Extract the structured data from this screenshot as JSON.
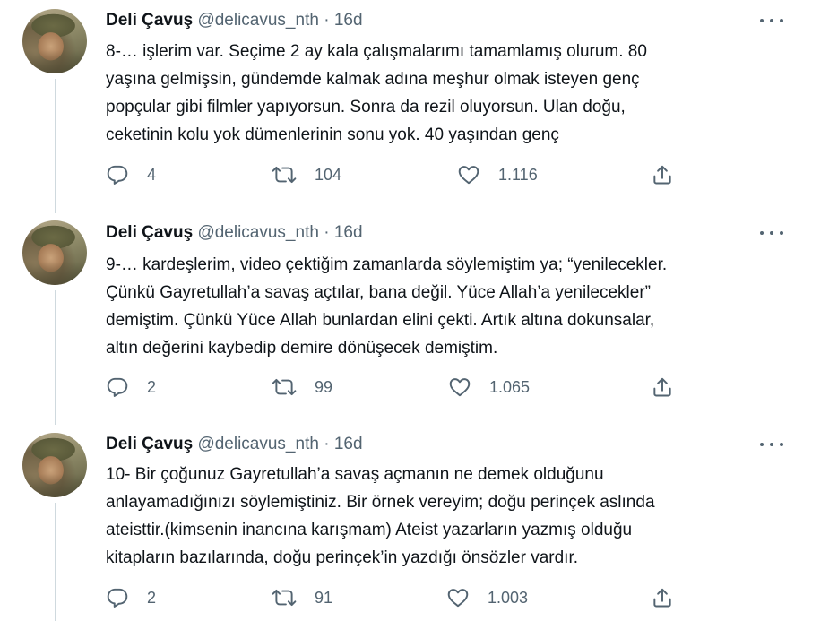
{
  "tweets": [
    {
      "name": "Deli Çavuş",
      "handle": "@delicavus_nth",
      "dot": "·",
      "time": "16d",
      "lines": [
        "8-… işlerim var. Seçime 2 ay kala çalışmalarımı tamamlamış olurum. 80",
        "yaşına gelmişsin, gündemde kalmak adına meşhur olmak isteyen genç",
        "popçular gibi filmler yapıyorsun. Sonra da rezil oluyorsun. Ulan doğu,",
        "ceketinin kolu yok dümenlerinin sonu yok. 40 yaşından genç"
      ],
      "replies": "4",
      "retweets": "104",
      "likes": "1.116"
    },
    {
      "name": "Deli Çavuş",
      "handle": "@delicavus_nth",
      "dot": "·",
      "time": "16d",
      "lines": [
        "9-… kardeşlerim, video çektiğim zamanlarda söylemiştim ya; “yenilecekler.",
        "Çünkü Gayretullah’a savaş açtılar, bana değil. Yüce Allah’a yenilecekler”",
        "demiştim. Çünkü Yüce Allah bunlardan elini çekti. Artık altına dokunsalar,",
        "altın değerini kaybedip demire dönüşecek demiştim."
      ],
      "replies": "2",
      "retweets": "99",
      "likes": "1.065"
    },
    {
      "name": "Deli Çavuş",
      "handle": "@delicavus_nth",
      "dot": "·",
      "time": "16d",
      "lines": [
        "10- Bir çoğunuz Gayretullah’a savaş açmanın ne demek olduğunu",
        "anlayamadığınızı söylemiştiniz. Bir örnek vereyim; doğu perinçek aslında",
        "ateisttir.(kimsenin inancına karışmam) Ateist yazarların yazmış olduğu",
        "kitapların bazılarında, doğu perinçek’in yazdığı önsözler vardır."
      ],
      "replies": "2",
      "retweets": "91",
      "likes": "1.003"
    }
  ],
  "icons": {
    "reply": "reply-icon",
    "retweet": "retweet-icon",
    "like": "like-icon",
    "share": "share-icon",
    "more": "more-icon"
  },
  "colors": {
    "text": "#0f1419",
    "secondary": "#536471",
    "thread_line": "#cfd9de",
    "background": "#ffffff"
  }
}
